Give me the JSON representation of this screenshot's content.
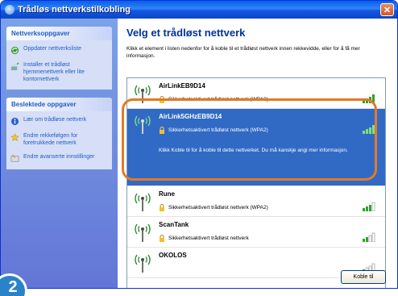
{
  "window": {
    "title": "Trådløs nettverkstilkobling"
  },
  "sidebar": {
    "network_tasks": {
      "title": "Nettverksoppgaver",
      "items": [
        {
          "label": "Oppdater nettverksliste",
          "icon": "refresh-icon"
        },
        {
          "label": "Installer et trådløst hjemmenettverk eller lite kontornettverk",
          "icon": "network-setup-icon"
        }
      ]
    },
    "related_tasks": {
      "title": "Beslektede oppgaver",
      "items": [
        {
          "label": "Lær om trådløse nettverk",
          "icon": "info-icon"
        },
        {
          "label": "Endre rekkefølgen for foretrukkede nettverk",
          "icon": "star-icon"
        },
        {
          "label": "Endre avanserte innstillinger",
          "icon": "settings-icon"
        }
      ]
    }
  },
  "main": {
    "heading": "Velg et trådløst nettverk",
    "instructions": "Klikk et element i listen nedenfor for å koble til et trådløst nettverk innen rekkevidde, eller for å få mer informasjon.",
    "networks": [
      {
        "name": "AirLinkEB9D14",
        "security": "Sikkerhetsaktivert trådløst nettverk (WPA2)",
        "signal": 4
      },
      {
        "name": "AirLink5GHzEB9D14",
        "security": "Sikkerhetsaktivert trådløst nettverk (WPA2)",
        "signal": 4,
        "description": "Klikk Koble til for å koble til dette nettverket. Du må kanskje angi mer informasjon."
      },
      {
        "name": "Rune",
        "security": "Sikkerhetsaktivert trådløst nettverk (WPA2)",
        "signal": 3
      },
      {
        "name": "ScanTank",
        "security": "Sikkerhetsaktivert trådløst nettverk",
        "signal": 2
      },
      {
        "name": "OKOLOS",
        "security": "",
        "signal": 1
      }
    ],
    "connect_label": "Koble til"
  },
  "step_badge": "2",
  "colors": {
    "title_bar": "#0a5ee8",
    "sidebar": "#6f8fdf",
    "selection": "#316ac5",
    "highlight": "#e27a28"
  }
}
